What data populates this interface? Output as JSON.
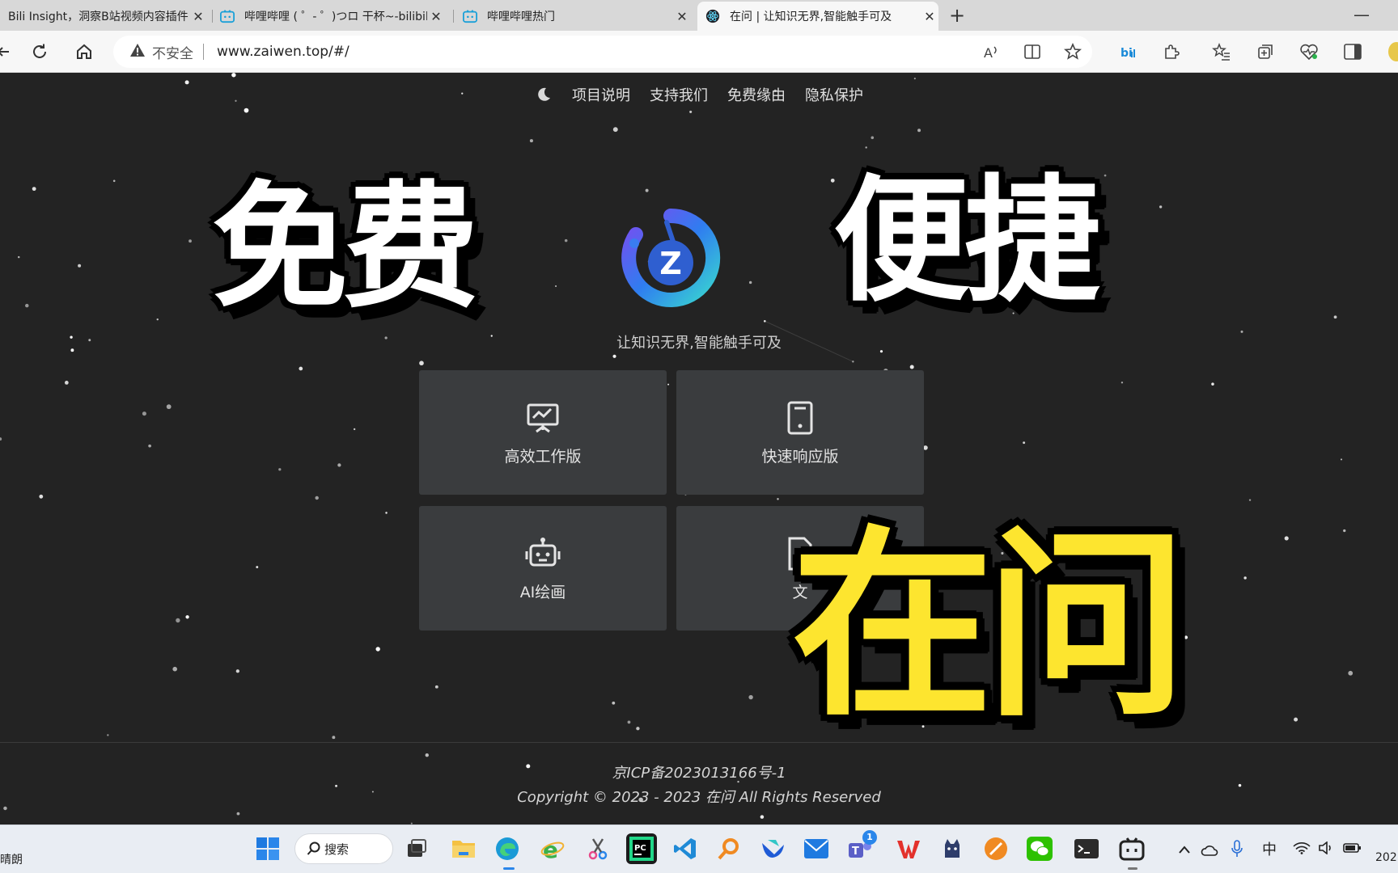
{
  "tabs": [
    {
      "title": "Bili Insight，洞察B站视频内容插件",
      "close": "✕"
    },
    {
      "title": "哔哩哔哩 ( ゜- ゜)つロ 干杯~-bilibili",
      "close": "✕"
    },
    {
      "title": "哔哩哔哩热门",
      "close": "✕"
    },
    {
      "title": "在问 | 让知识无界,智能触手可及",
      "close": "✕"
    }
  ],
  "new_tab": "+",
  "minimize": "—",
  "address": {
    "insecure_label": "不安全",
    "url": "www.zaiwen.top/#/"
  },
  "toolbar_icons": [
    "read-aloud-icon",
    "split-screen-icon",
    "favorite-icon",
    "bilibili-ext-icon",
    "extensions-icon",
    "favorites-icon",
    "collections-icon",
    "performance-icon",
    "sidebar-icon"
  ],
  "site": {
    "nav": [
      "项目说明",
      "支持我们",
      "免费缘由",
      "隐私保护"
    ],
    "slogan": "让知识无界,智能触手可及",
    "cards": [
      {
        "label": "高效工作版",
        "icon": "presentation-icon"
      },
      {
        "label": "快速响应版",
        "icon": "tablet-icon"
      },
      {
        "label": "AI绘画",
        "icon": "robot-icon"
      },
      {
        "label": "文",
        "icon": "document-icon"
      }
    ],
    "icp": "京ICP备2023013166号-1",
    "copyright": "Copyright © 2023 - 2023 在问 All Rights Reserved"
  },
  "overlay": {
    "left": "免费",
    "right": "便捷",
    "main": "在问"
  },
  "taskbar": {
    "weather": "晴朗",
    "search_label": "搜索",
    "badge_count": "1",
    "ime": "中",
    "clock": "202"
  },
  "colors": {
    "page_bg": "#232323",
    "card_bg": "#3a3c3e",
    "sticker_yellow": "#fde52f"
  }
}
